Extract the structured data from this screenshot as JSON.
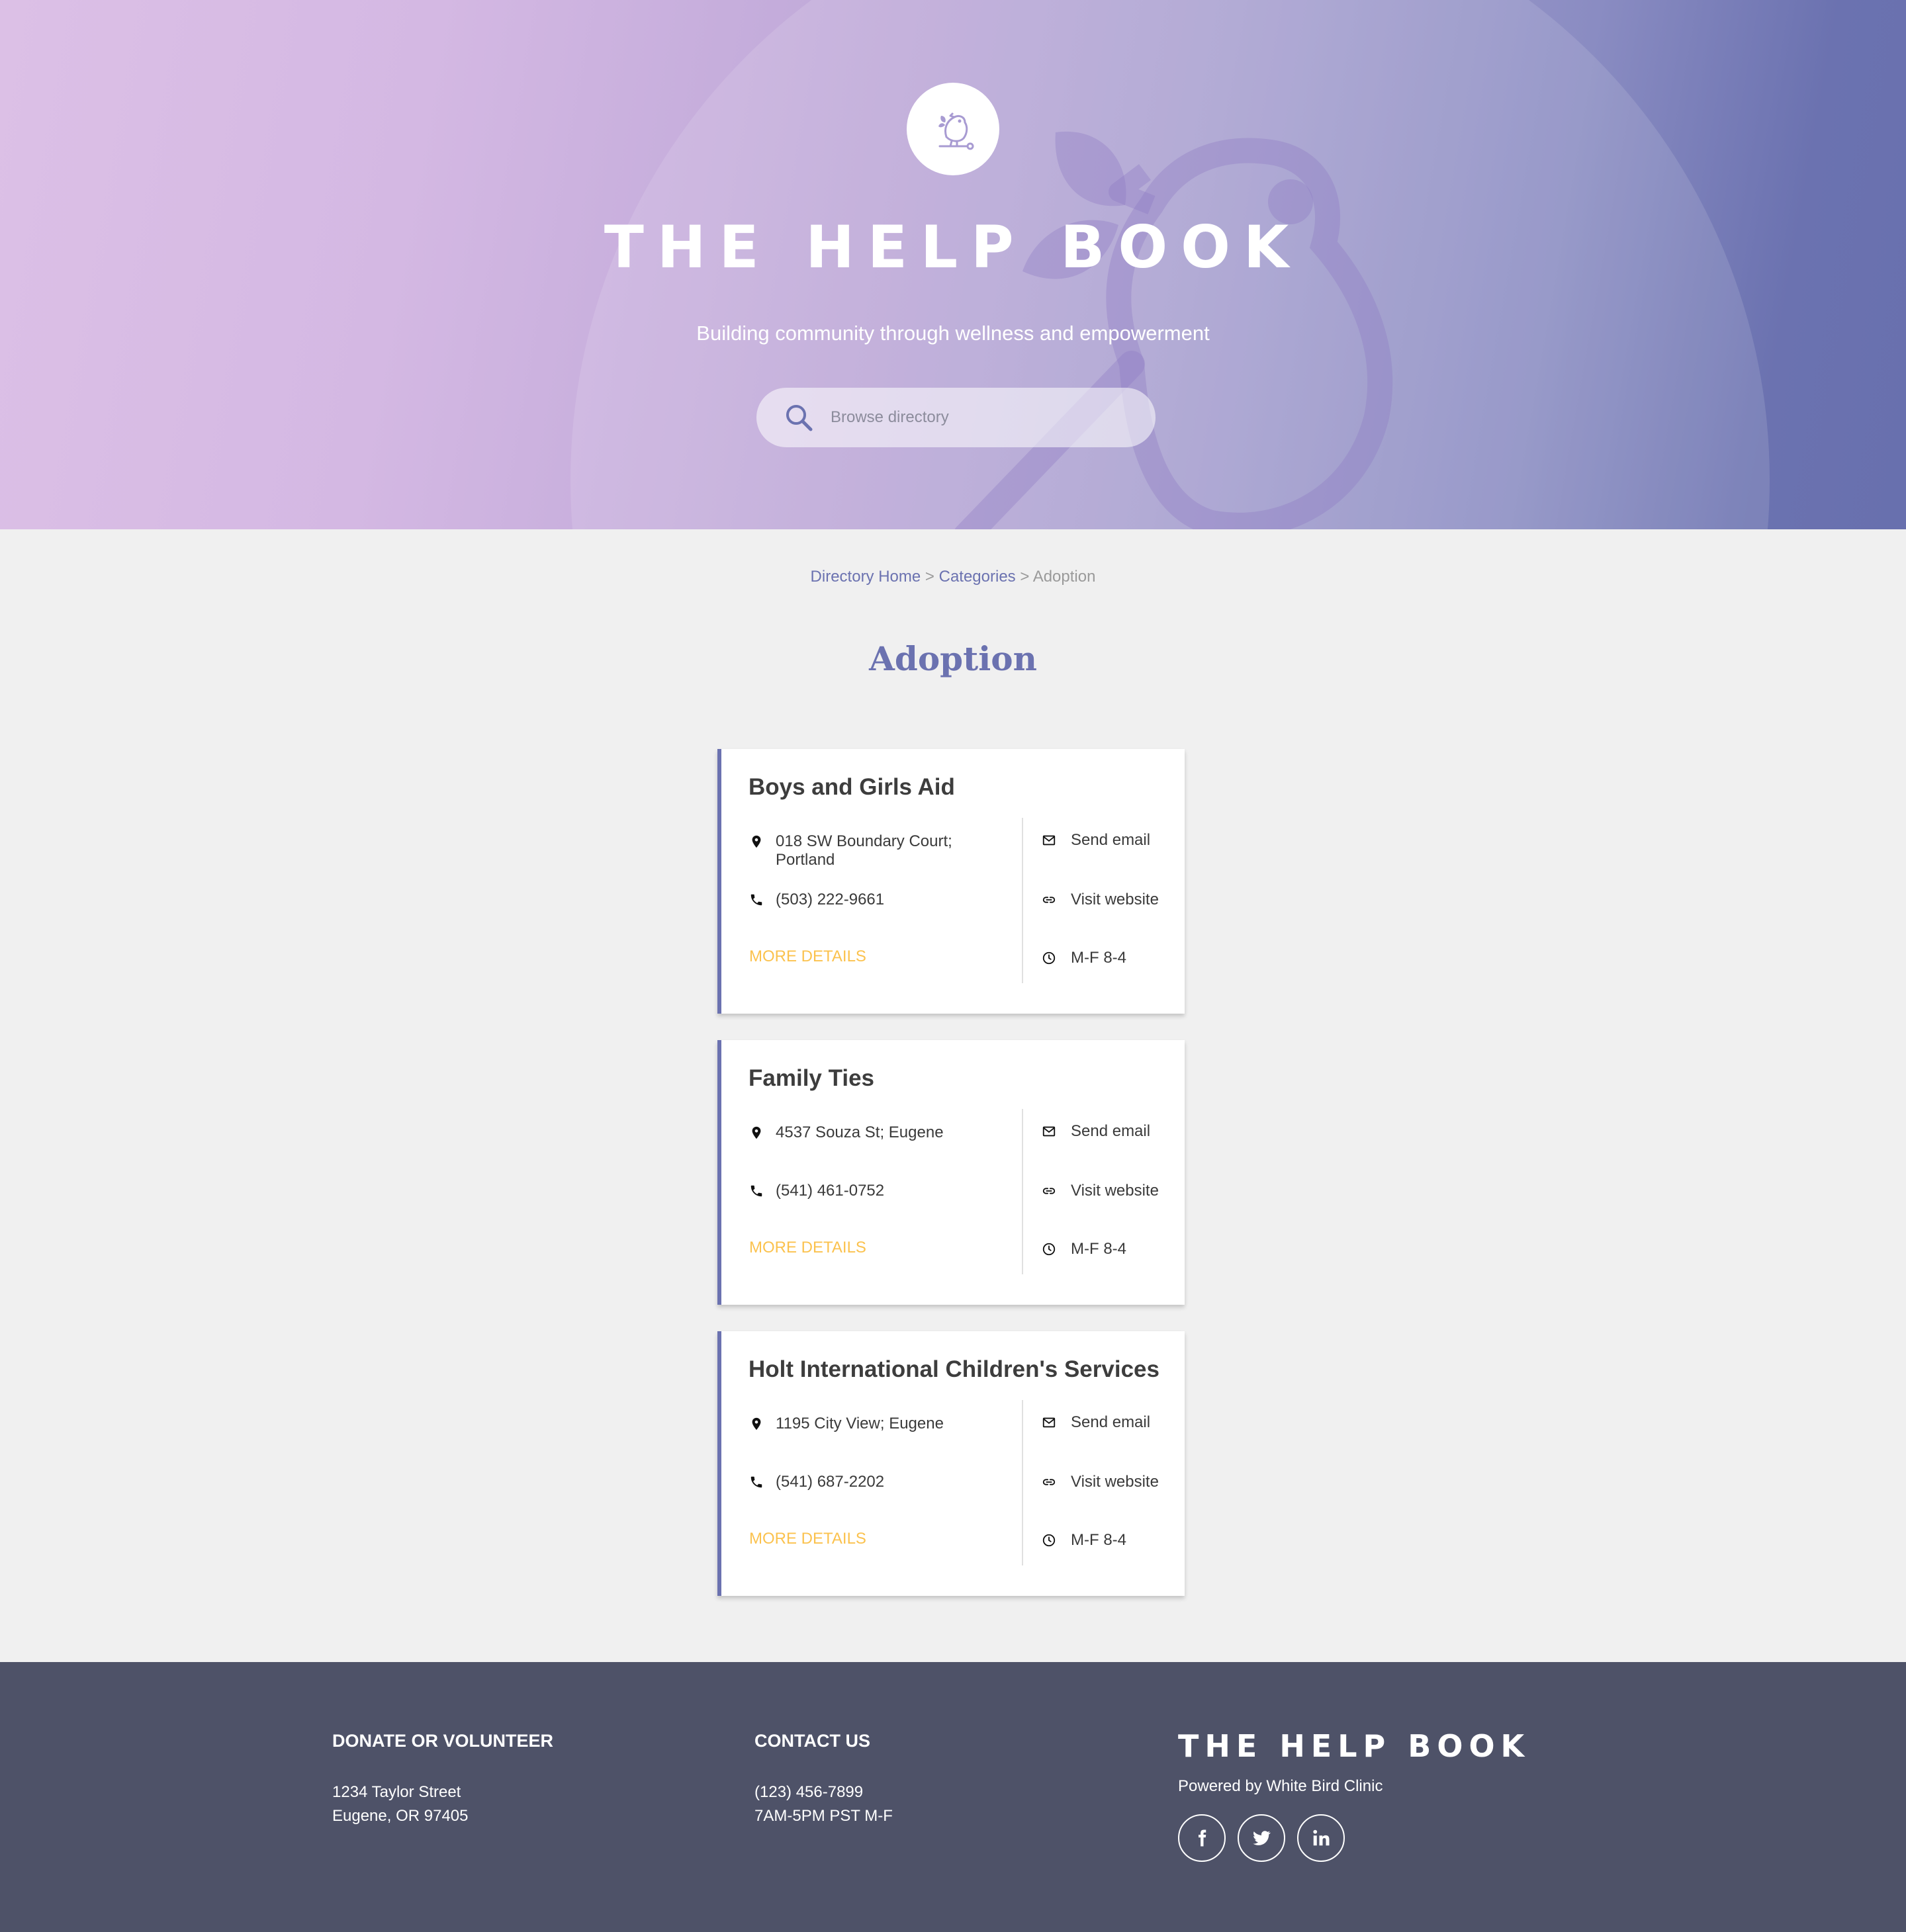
{
  "hero": {
    "title": "THE HELP BOOK",
    "subtitle": "Building community through wellness and empowerment",
    "search_placeholder": "Browse directory"
  },
  "breadcrumb": {
    "items": [
      "Directory Home",
      "Categories",
      "Adoption"
    ],
    "separator": ">"
  },
  "page_title": "Adoption",
  "listings": [
    {
      "name": "Boys and Girls Aid",
      "address": "018 SW Boundary Court; Portland",
      "phone": "(503) 222-9661",
      "more_label": "MORE DETAILS",
      "email_label": "Send email",
      "website_label": "Visit website",
      "hours": "M-F 8-4"
    },
    {
      "name": "Family Ties",
      "address": "4537 Souza St; Eugene",
      "phone": "(541) 461-0752",
      "more_label": "MORE DETAILS",
      "email_label": "Send email",
      "website_label": "Visit website",
      "hours": "M-F 8-4"
    },
    {
      "name": "Holt International Children's Services",
      "address": "1195 City View; Eugene",
      "phone": "(541) 687-2202",
      "more_label": "MORE DETAILS",
      "email_label": "Send email",
      "website_label": "Visit website",
      "hours": "M-F 8-4"
    }
  ],
  "footer": {
    "donate": {
      "heading": "DONATE OR VOLUNTEER",
      "line1": "1234 Taylor Street",
      "line2": "Eugene, OR 97405"
    },
    "contact": {
      "heading": "CONTACT US",
      "line1": "(123) 456-7899",
      "line2": "7AM-5PM PST M-F"
    },
    "brand": "THE HELP BOOK",
    "powered_by": "Powered by White Bird Clinic",
    "social": [
      "facebook-icon",
      "twitter-icon",
      "linkedin-icon"
    ]
  },
  "colors": {
    "accent": "#6b72b0",
    "more_link": "#fbc24e",
    "footer_bg": "#4e5268",
    "page_bg": "#f0f0f0"
  }
}
